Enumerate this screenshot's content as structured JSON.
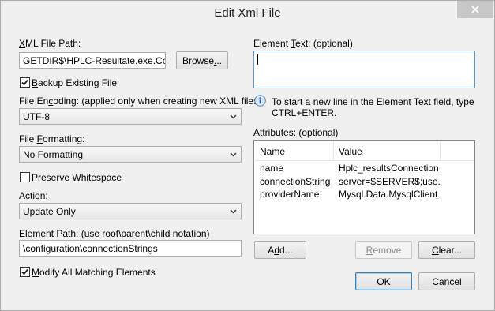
{
  "window": {
    "title": "Edit Xml File"
  },
  "left": {
    "xml_path": {
      "label_pre": "",
      "label_u": "X",
      "label_post": "ML File Path:",
      "value": "GETDIR$\\HPLC-Resultate.exe.Config",
      "browse_pre": "Browse",
      "browse_u": ".",
      "browse_post": ".."
    },
    "backup": {
      "label_pre": "",
      "label_u": "B",
      "label_post": "ackup Existing File",
      "checked": true
    },
    "encoding": {
      "label_pre": "File En",
      "label_u": "c",
      "label_post": "oding: (applied only when creating new XML files)",
      "value": "UTF-8"
    },
    "formatting": {
      "label_pre": "File ",
      "label_u": "F",
      "label_post": "ormatting:",
      "value": "No Formatting"
    },
    "whitespace": {
      "label_pre": "Preserve ",
      "label_u": "W",
      "label_post": "hitespace",
      "checked": false
    },
    "action": {
      "label_pre": "Actio",
      "label_u": "n",
      "label_post": ":",
      "value": "Update Only"
    },
    "element_path": {
      "label_pre": "",
      "label_u": "E",
      "label_post": "lement Path: (use root\\parent\\child notation)",
      "value": "\\configuration\\connectionStrings"
    },
    "modify_all": {
      "label_pre": "",
      "label_u": "M",
      "label_post": "odify All Matching Elements",
      "checked": true
    }
  },
  "right": {
    "element_text": {
      "label_pre": "Element ",
      "label_u": "T",
      "label_post": "ext: (optional)",
      "value": ""
    },
    "info": {
      "line1": "To start a new line in the Element Text field, type",
      "line2": "CTRL+ENTER.",
      "icon": "info-icon"
    },
    "attributes": {
      "label_pre": "",
      "label_u": "A",
      "label_post": "ttributes: (optional)",
      "columns": [
        "Name",
        "Value"
      ],
      "rows": [
        {
          "name": "name",
          "value": "Hplc_resultsConnection"
        },
        {
          "name": "connectionString",
          "value": "server=$SERVER$;use..."
        },
        {
          "name": "providerName",
          "value": "Mysql.Data.MysqlClient"
        }
      ]
    },
    "buttons": {
      "add": {
        "pre": "A",
        "u": "d",
        "post": "d..."
      },
      "remove": {
        "pre": "",
        "u": "R",
        "post": "emove"
      },
      "clear": {
        "pre": "",
        "u": "C",
        "post": "lear..."
      },
      "ok": "OK",
      "cancel": "Cancel"
    }
  },
  "colors": {
    "accent": "#3c7fb1",
    "close_button": "#c7c7c7",
    "window_bg": "#f0f0f0"
  }
}
